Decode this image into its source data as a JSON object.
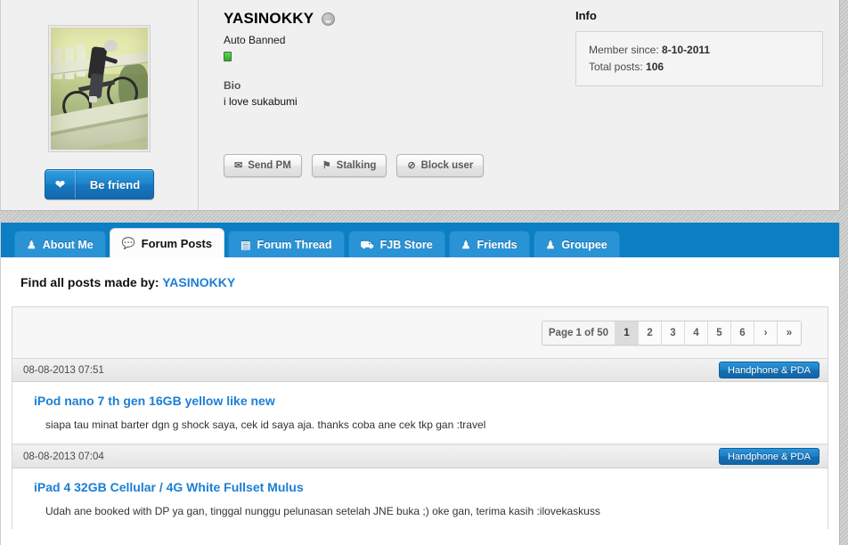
{
  "profile": {
    "avatar_alt": "cyclist on bicycle riding down concrete steps",
    "be_friend_label": "Be friend",
    "be_friend_icon": "heart-icon",
    "username": "YASINOKKY",
    "status_icon": "gray-smiley-offline-icon",
    "usertitle": "Auto Banned",
    "online_badge": "green-online-indicator",
    "bio_heading": "Bio",
    "bio_text": "i love sukabumi",
    "actions": [
      {
        "label": "Send PM",
        "icon": "envelope-icon",
        "glyph": "✉"
      },
      {
        "label": "Stalking",
        "icon": "bookmark-icon",
        "glyph": "⚑"
      },
      {
        "label": "Block user",
        "icon": "eye-slash-icon",
        "glyph": "⊘"
      }
    ]
  },
  "info": {
    "heading": "Info",
    "member_since_label": "Member since:",
    "member_since_value": "8-10-2011",
    "total_posts_label": "Total posts:",
    "total_posts_value": "106"
  },
  "tabs": [
    {
      "label": "About Me",
      "icon": "person-bust-icon",
      "glyph": "♟",
      "active": false
    },
    {
      "label": "Forum Posts",
      "icon": "speech-bubble-icon",
      "glyph": "●",
      "active": true
    },
    {
      "label": "Forum Thread",
      "icon": "calendar-icon",
      "glyph": "▤",
      "active": false
    },
    {
      "label": "FJB Store",
      "icon": "shopping-cart-icon",
      "glyph": "⛟",
      "active": false
    },
    {
      "label": "Friends",
      "icon": "person-icon",
      "glyph": "♟",
      "active": false
    },
    {
      "label": "Groupee",
      "icon": "group-people-icon",
      "glyph": "♟",
      "active": false
    }
  ],
  "find_posts": {
    "prefix": "Find all posts made by:",
    "username": "YASINOKKY"
  },
  "pagination": {
    "page_label": "Page 1 of 50",
    "pages": [
      "1",
      "2",
      "3",
      "4",
      "5",
      "6"
    ],
    "current": "1",
    "next_glyph": "›",
    "last_glyph": "»"
  },
  "posts": [
    {
      "date": "08-08-2013 07:51",
      "category": "Handphone & PDA",
      "title": "iPod nano 7 th gen 16GB yellow like new",
      "excerpt": "siapa tau minat barter dgn g shock saya, cek id saya aja. thanks coba ane cek tkp gan :travel"
    },
    {
      "date": "08-08-2013 07:04",
      "category": "Handphone & PDA",
      "title": "iPad 4 32GB Cellular / 4G White Fullset Mulus",
      "excerpt": "Udah ane booked with DP ya gan, tinggal nunggu pelunasan setelah JNE buka ;) oke gan, terima kasih :ilovekaskuss"
    }
  ],
  "colors": {
    "accent_blue": "#1b7fd4",
    "tabbar_blue": "#0b7ec4",
    "tab_inactive": "#2a93d6",
    "online_green": "#25b41e",
    "panel_bg": "#f0f0f0"
  }
}
